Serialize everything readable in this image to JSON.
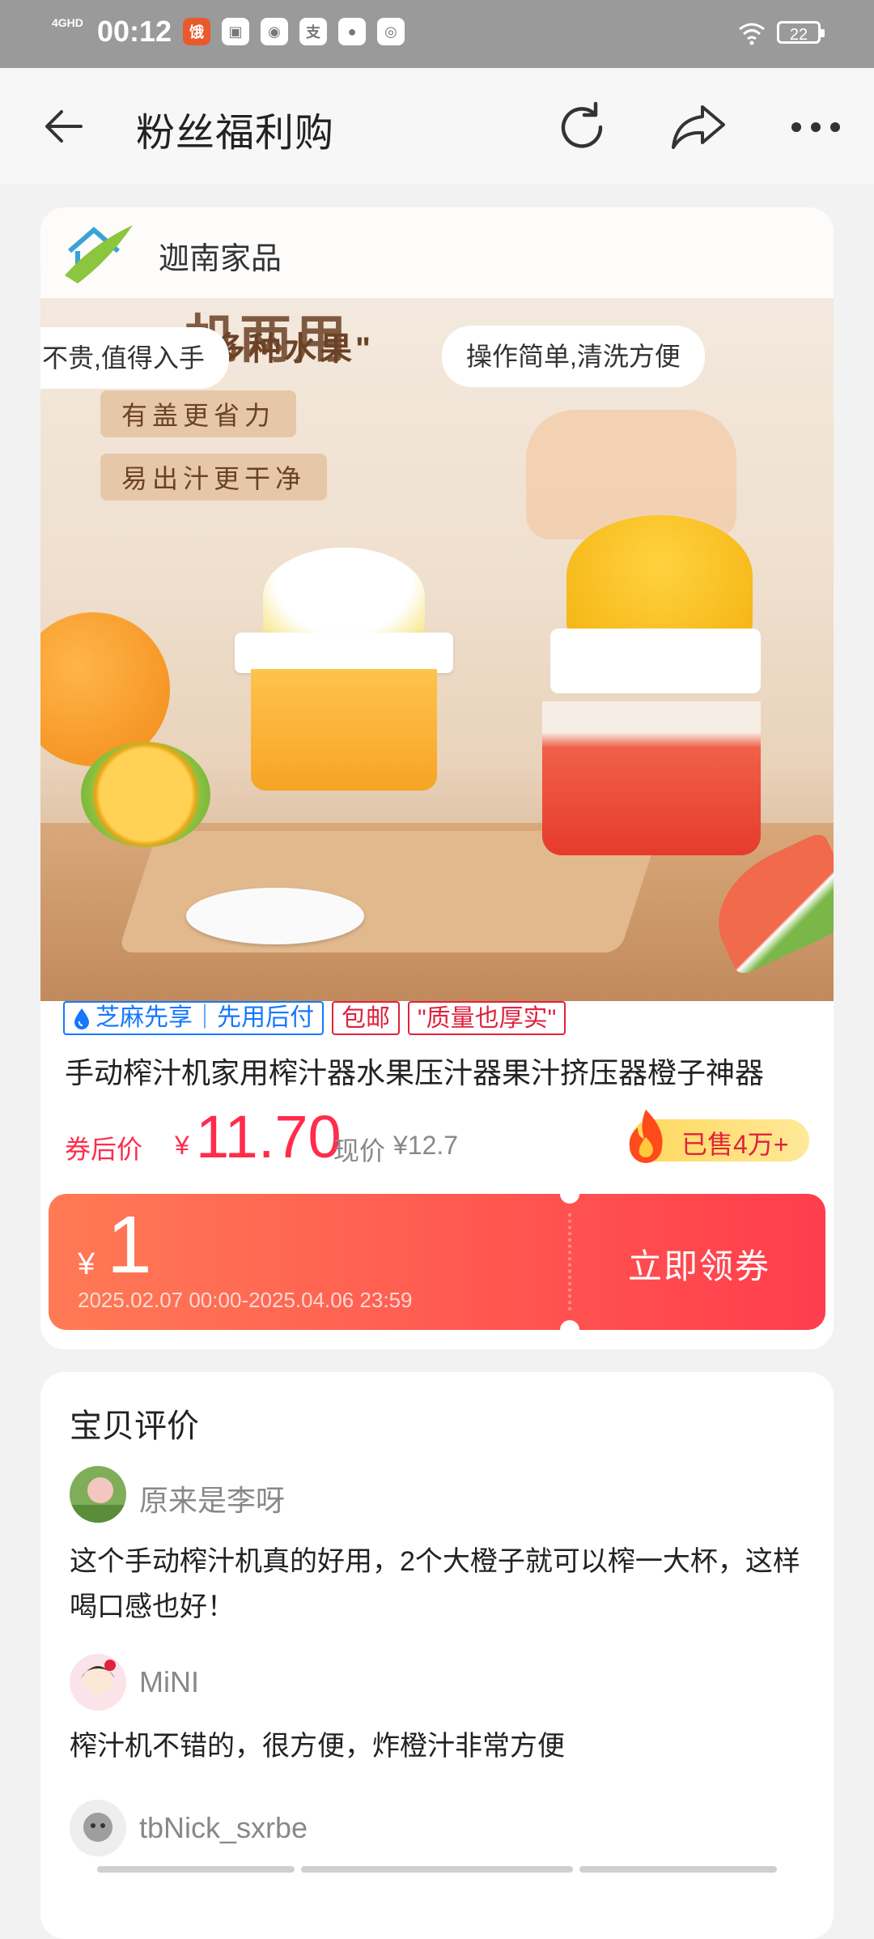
{
  "status_bar": {
    "network": "4GHD",
    "time": "00:12",
    "battery": "22",
    "app_icons": [
      "饿",
      "bud",
      "JOVI",
      "支",
      "msg",
      "map"
    ]
  },
  "nav": {
    "title": "粉丝福利购"
  },
  "product": {
    "store_name": "迦南家品",
    "image_headline": "一机两用",
    "image_subline": "\"可榨多种水果\"",
    "image_pill_left": "用不贵,值得入手",
    "image_pill_right": "操作简单,清洗方便",
    "image_tag_1": "有盖更省力",
    "image_tag_2": "易出汁更干净",
    "badges": {
      "zhima": "芝麻先享｜先用后付",
      "free_shipping": "包邮",
      "quality": "\"质量也厚实\""
    },
    "title": "手动榨汁机家用榨汁器水果压汁器果汁挤压器橙子神器",
    "price_label": "券后价",
    "currency": "¥",
    "price": "11.70",
    "current_price_label": "现价",
    "current_price": "¥12.7",
    "sold": "已售4万+"
  },
  "coupon": {
    "currency": "¥",
    "value": "1",
    "validity": "2025.02.07 00:00-2025.04.06 23:59",
    "button_label": "立即领券"
  },
  "reviews": {
    "title": "宝贝评价",
    "items": [
      {
        "user": "原来是李呀",
        "text": "这个手动榨汁机真的好用，2个大橙子就可以榨一大杯，这样喝口感也好！"
      },
      {
        "user": "MiNI",
        "text": "榨汁机不错的，很方便，炸橙汁非常方便"
      },
      {
        "user": "tbNick_sxrbe",
        "text": ""
      }
    ]
  },
  "colors": {
    "accent_red": "#ff2c4b",
    "coupon_start": "#ff7a55",
    "coupon_end": "#ff3d4d",
    "zhima_blue": "#1677ff"
  }
}
